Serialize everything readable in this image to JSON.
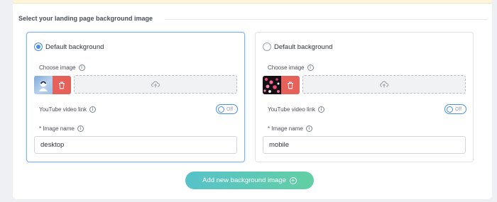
{
  "section": {
    "title": "Select your landing page background image"
  },
  "cards": [
    {
      "radio_label": "Default background",
      "selected": true,
      "choose_image_label": "Choose image",
      "youtube_label": "YouTube video link",
      "toggle_text": "Off",
      "image_name_label": "* Image name",
      "image_name_value": "desktop",
      "info_glyph": "i"
    },
    {
      "radio_label": "Default background",
      "selected": false,
      "choose_image_label": "Choose image",
      "youtube_label": "YouTube video link",
      "toggle_text": "Off",
      "image_name_label": "* Image name",
      "image_name_value": "mobile",
      "info_glyph": "i"
    }
  ],
  "add_button": {
    "label": "Add new background image",
    "icon_glyph": "+"
  },
  "colors": {
    "accent": "#4a90e2",
    "delete": "#e5615a",
    "button_gradient_start": "#57c2c9",
    "button_gradient_end": "#62cfa4"
  }
}
